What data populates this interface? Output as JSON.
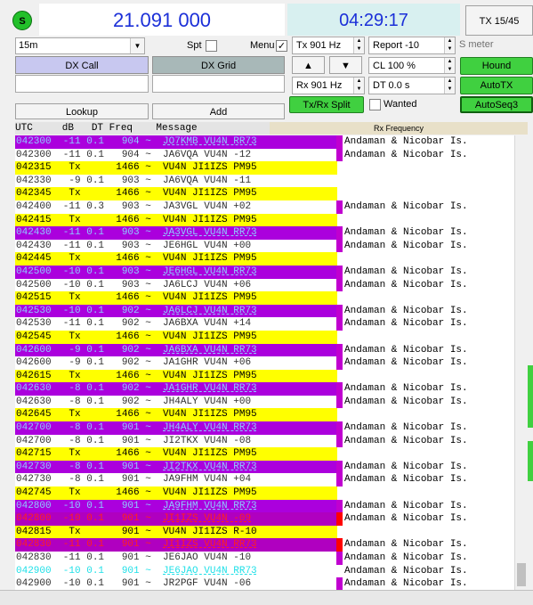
{
  "top": {
    "s_indicator": "S",
    "dial_freq": "21.091 000",
    "clock": "04:29:17",
    "tx_button": "TX 15/45"
  },
  "controls": {
    "band": "15m",
    "spt_label": "Spt",
    "menu_label": "Menu",
    "menu_checked": "✓",
    "tx_freq": "Tx  901  Hz",
    "report": "Report -10",
    "s_meter_label": "S meter",
    "dx_call_label": "DX Call",
    "dx_grid_label": "DX Grid",
    "up_arrow": "▲",
    "down_arrow": "▼",
    "cl_value": "CL  100 %",
    "hound_label": "Hound",
    "rx_freq": "Rx  901  Hz",
    "dt_value": "DT 0.0 s",
    "autotx_label": "AutoTX",
    "lookup_label": "Lookup",
    "add_label": "Add",
    "txrx_split_label": "Tx/Rx Split",
    "wanted_label": "Wanted",
    "autoseq_label": "AutoSeq3"
  },
  "table": {
    "header": "UTC     dB   DT Freq    Message",
    "rx_frequency_label": "Rx Frequency",
    "rows": [
      {
        "utc": "042300",
        "db": "-11",
        "dt": "0.1",
        "freq": "904",
        "msg": "JO7KMB VU4N RR73",
        "right": "Andaman & Nicobar Is.",
        "style": "blue"
      },
      {
        "utc": "042300",
        "db": "-11",
        "dt": "0.1",
        "freq": "904",
        "msg": "JA6VQA VU4N -12",
        "right": "Andaman & Nicobar Is.",
        "style": "white"
      },
      {
        "utc": "042315",
        "db": "Tx",
        "dt": "",
        "freq": "1466",
        "msg": "VU4N JI1IZS PM95",
        "right": "",
        "style": "tx"
      },
      {
        "utc": "042330",
        "db": "-9",
        "dt": "0.1",
        "freq": "903",
        "msg": "JA6VQA VU4N -11",
        "right": "",
        "style": "white"
      },
      {
        "utc": "042345",
        "db": "Tx",
        "dt": "",
        "freq": "1466",
        "msg": "VU4N JI1IZS PM95",
        "right": "",
        "style": "tx"
      },
      {
        "utc": "042400",
        "db": "-11",
        "dt": "0.3",
        "freq": "903",
        "msg": "JA3VGL VU4N +02",
        "right": "Andaman & Nicobar Is.",
        "style": "white"
      },
      {
        "utc": "042415",
        "db": "Tx",
        "dt": "",
        "freq": "1466",
        "msg": "VU4N JI1IZS PM95",
        "right": "",
        "style": "tx"
      },
      {
        "utc": "042430",
        "db": "-11",
        "dt": "0.1",
        "freq": "903",
        "msg": "JA3VGL VU4N RR73",
        "right": "Andaman & Nicobar Is.",
        "style": "blue"
      },
      {
        "utc": "042430",
        "db": "-11",
        "dt": "0.1",
        "freq": "903",
        "msg": "JE6HGL VU4N +00",
        "right": "Andaman & Nicobar Is.",
        "style": "white"
      },
      {
        "utc": "042445",
        "db": "Tx",
        "dt": "",
        "freq": "1466",
        "msg": "VU4N JI1IZS PM95",
        "right": "",
        "style": "tx"
      },
      {
        "utc": "042500",
        "db": "-10",
        "dt": "0.1",
        "freq": "903",
        "msg": "JE6HGL VU4N RR73",
        "right": "Andaman & Nicobar Is.",
        "style": "blue"
      },
      {
        "utc": "042500",
        "db": "-10",
        "dt": "0.1",
        "freq": "903",
        "msg": "JA6LCJ VU4N +06",
        "right": "Andaman & Nicobar Is.",
        "style": "white"
      },
      {
        "utc": "042515",
        "db": "Tx",
        "dt": "",
        "freq": "1466",
        "msg": "VU4N JI1IZS PM95",
        "right": "",
        "style": "tx"
      },
      {
        "utc": "042530",
        "db": "-10",
        "dt": "0.1",
        "freq": "902",
        "msg": "JA6LCJ VU4N RR73",
        "right": "Andaman & Nicobar Is.",
        "style": "blue"
      },
      {
        "utc": "042530",
        "db": "-11",
        "dt": "0.1",
        "freq": "902",
        "msg": "JA6BXA VU4N +14",
        "right": "Andaman & Nicobar Is.",
        "style": "white"
      },
      {
        "utc": "042545",
        "db": "Tx",
        "dt": "",
        "freq": "1466",
        "msg": "VU4N JI1IZS PM95",
        "right": "",
        "style": "tx"
      },
      {
        "utc": "042600",
        "db": "-9",
        "dt": "0.1",
        "freq": "902",
        "msg": "JA6BXA VU4N RR73",
        "right": "Andaman & Nicobar Is.",
        "style": "blue"
      },
      {
        "utc": "042600",
        "db": "-9",
        "dt": "0.1",
        "freq": "902",
        "msg": "JA1GHR VU4N +06",
        "right": "Andaman & Nicobar Is.",
        "style": "white"
      },
      {
        "utc": "042615",
        "db": "Tx",
        "dt": "",
        "freq": "1466",
        "msg": "VU4N JI1IZS PM95",
        "right": "",
        "style": "tx"
      },
      {
        "utc": "042630",
        "db": "-8",
        "dt": "0.1",
        "freq": "902",
        "msg": "JA1GHR VU4N RR73",
        "right": "Andaman & Nicobar Is.",
        "style": "blue"
      },
      {
        "utc": "042630",
        "db": "-8",
        "dt": "0.1",
        "freq": "902",
        "msg": "JH4ALY VU4N +00",
        "right": "Andaman & Nicobar Is.",
        "style": "white"
      },
      {
        "utc": "042645",
        "db": "Tx",
        "dt": "",
        "freq": "1466",
        "msg": "VU4N JI1IZS PM95",
        "right": "",
        "style": "tx"
      },
      {
        "utc": "042700",
        "db": "-8",
        "dt": "0.1",
        "freq": "901",
        "msg": "JH4ALY VU4N RR73",
        "right": "Andaman & Nicobar Is.",
        "style": "blue"
      },
      {
        "utc": "042700",
        "db": "-8",
        "dt": "0.1",
        "freq": "901",
        "msg": "JI2TKX VU4N -08",
        "right": "Andaman & Nicobar Is.",
        "style": "white"
      },
      {
        "utc": "042715",
        "db": "Tx",
        "dt": "",
        "freq": "1466",
        "msg": "VU4N JI1IZS PM95",
        "right": "",
        "style": "tx"
      },
      {
        "utc": "042730",
        "db": "-8",
        "dt": "0.1",
        "freq": "901",
        "msg": "JI2TKX VU4N RR73",
        "right": "Andaman & Nicobar Is.",
        "style": "blue"
      },
      {
        "utc": "042730",
        "db": "-8",
        "dt": "0.1",
        "freq": "901",
        "msg": "JA9FHM VU4N +04",
        "right": "Andaman & Nicobar Is.",
        "style": "white"
      },
      {
        "utc": "042745",
        "db": "Tx",
        "dt": "",
        "freq": "1466",
        "msg": "VU4N JI1IZS PM95",
        "right": "",
        "style": "tx"
      },
      {
        "utc": "042800",
        "db": "-10",
        "dt": "0.1",
        "freq": "901",
        "msg": "JA9FHM VU4N RR73",
        "right": "Andaman & Nicobar Is.",
        "style": "blue"
      },
      {
        "utc": "042800",
        "db": "-10",
        "dt": "0.1",
        "freq": "901",
        "msg": "JI1IZS VU4N -09",
        "right": "Andaman & Nicobar Is.",
        "style": "red"
      },
      {
        "utc": "042815",
        "db": "Tx",
        "dt": "",
        "freq": "901",
        "msg": "VU4N JI1IZS R-10",
        "right": "",
        "style": "tx"
      },
      {
        "utc": "042830",
        "db": "-11",
        "dt": "0.1",
        "freq": "901",
        "msg": "JI1IZS VU4N RR73",
        "right": "Andaman & Nicobar Is.",
        "style": "red"
      },
      {
        "utc": "042830",
        "db": "-11",
        "dt": "0.1",
        "freq": "901",
        "msg": "JE6JAO VU4N -10",
        "right": "Andaman & Nicobar Is.",
        "style": "white"
      },
      {
        "utc": "042900",
        "db": "-10",
        "dt": "0.1",
        "freq": "901",
        "msg": "JE6JAO VU4N RR73",
        "right": "Andaman & Nicobar Is.",
        "style": "cyan"
      },
      {
        "utc": "042900",
        "db": "-10",
        "dt": "0.1",
        "freq": "901",
        "msg": "JR2PGF VU4N -06",
        "right": "Andaman & Nicobar Is.",
        "style": "white"
      }
    ]
  },
  "colors": {
    "blue_bg": "#ab00dd",
    "blue_fg": "#8ecbff",
    "tx_bg": "#ffff00",
    "red_bg": "#b000c0",
    "red_fg": "#ff2020",
    "cyan_fg": "#20e0e8",
    "marker": "#c000d0",
    "marker_red": "#ff0000"
  }
}
